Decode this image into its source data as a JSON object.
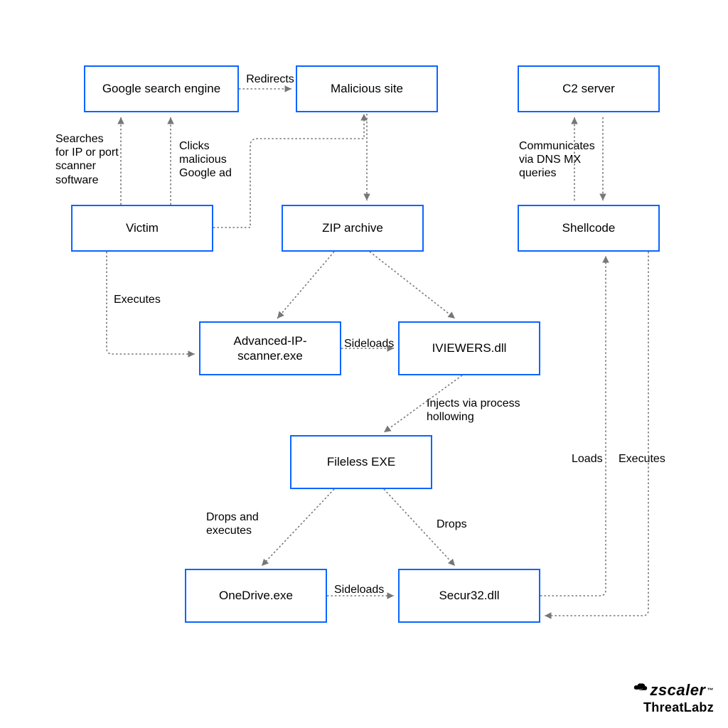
{
  "nodes": {
    "google": {
      "label": "Google search engine"
    },
    "malsite": {
      "label": "Malicious site"
    },
    "c2": {
      "label": "C2 server"
    },
    "victim": {
      "label": "Victim"
    },
    "zip": {
      "label": "ZIP archive"
    },
    "shellcode": {
      "label": "Shellcode"
    },
    "advip": {
      "label": "Advanced-IP-\nscanner.exe"
    },
    "iviewers": {
      "label": "IVIEWERS.dll"
    },
    "fileless": {
      "label": "Fileless EXE"
    },
    "onedrive": {
      "label": "OneDrive.exe"
    },
    "secur32": {
      "label": "Secur32.dll"
    }
  },
  "edges": {
    "redirects": "Redirects",
    "searches": "Searches\nfor IP or port\nscanner\nsoftware",
    "clicksAd": "Clicks\nmalicious\nGoogle ad",
    "commDns": "Communicates\nvia DNS MX\nqueries",
    "executes1": "Executes",
    "sideloads1": "Sideloads",
    "injects": "Injects via process\nhollowing",
    "dropsExec": "Drops and\nexecutes",
    "drops": "Drops",
    "sideloads2": "Sideloads",
    "loads": "Loads",
    "executes2": "Executes"
  },
  "brand": {
    "company": "zscaler",
    "tm": "™",
    "team": "ThreatLabz"
  }
}
